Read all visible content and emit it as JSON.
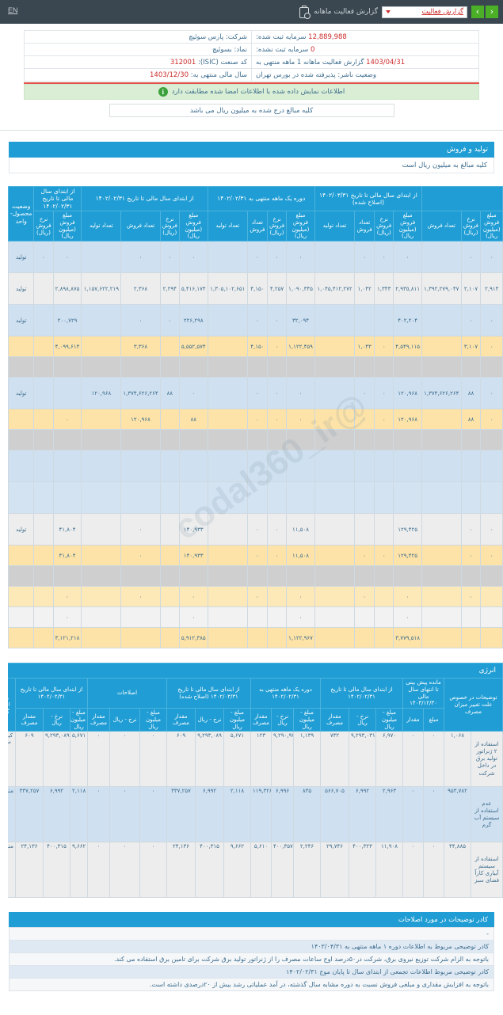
{
  "topbar": {
    "icon": "clipboard-check-icon",
    "title": "گزارش فعالیت ماهانه",
    "selected_report": "گزارش فعالیت",
    "prev_label": "‹",
    "next_label": "›",
    "en_label": "EN",
    "accent_green": "#4caf28",
    "bar_color": "#3a4750"
  },
  "info": {
    "company_label": "شرکت:",
    "company_value": "پارس سوئیچ",
    "symbol_label": "نماد:",
    "symbol_value": "بسوئیچ",
    "isic_label": "کد صنعت (ISIC):",
    "isic_value": "312001",
    "fiscal_label": "سال مالی منتهی به:",
    "fiscal_value": "1403/12/30",
    "registered_capital_label": "سرمایه ثبت شده:",
    "registered_capital_value": "12,889,988",
    "unregistered_capital_label": "سرمایه ثبت نشده:",
    "unregistered_capital_value": "0",
    "period_label": "گزارش فعالیت ماهانه  1  ماهه منتهی به",
    "period_value": "1403/04/31",
    "issuer_status_label": "وضعیت ناشر:",
    "issuer_status_value": "پذیرفته شده در بورس تهران",
    "green_note": "اطلاعات نمایش داده شده با اطلاعات امضا شده مطابقت دارد",
    "million_note": "کلیه مبالغ درج شده به میلیون ریال می باشد"
  },
  "production_section": {
    "title": "تولید و فروش",
    "subtitle": "کلیه مبالغ به میلیون ریال است",
    "watermark": "@codal360_ir",
    "group_headers": [
      "از ابتدای سال مالی تا تاریخ ۱۴۰۲/۰۳/۳۱ (اصلاح شده)",
      "دوره یک ماهه منتهی به ۱۴۰۲/۰۲/۳۱",
      "از ابتدای سال مالی تا تاریخ ۱۴۰۲/۰۲/۳۱",
      "از ابتدای سال مالی تا تاریخ ۱۴۰۲/۰۲/۳۱",
      "وضعیت محصول-واحد"
    ],
    "sub_headers": [
      "تعداد تولید",
      "تعداد فروش",
      "نرخ فروش (ریال)",
      "مبلغ فروش (میلیون ریال)"
    ],
    "status_col": "وضعیت محصول-واحد",
    "rows": [
      {
        "style": "blue",
        "status": "تولید",
        "cells": [
          "٠",
          "٠",
          "",
          "٠",
          "٠",
          "٠",
          "",
          "٠",
          "٠",
          "٠",
          "",
          "٠",
          "٠",
          "٠",
          "",
          "٠",
          "٠"
        ]
      },
      {
        "style": "grey",
        "status": "تولید",
        "cells": [
          "٢,٩١۴",
          "٢,١٠٧",
          "١,٣٩٢,٢٧٩,٠۴٧",
          "٢,٩٣٥,٨١١",
          "١,٣۴٣",
          "١,٠۴٢",
          "١,٠۴۵,۴١٢,٢٧٢",
          "١,٠٩٠,٣۴۵",
          "۴,٢۵٧",
          "۴,١۵٠",
          "١,٣٠۵,١٠٢,۶۵١",
          "۵,۴١۶,١٧۴",
          "٢,٢٩۴",
          "٢,٣۶٨",
          "١,١۵٧,۶٢٢,٢١٩",
          "٢,٨٩٨,٨٧۵"
        ]
      },
      {
        "style": "blue",
        "status": "تولید",
        "cells": [
          "٠",
          "٠",
          "",
          "۴٠٢,٢٠۴",
          "",
          "",
          "",
          "٣٢,٠٩۴",
          "٠",
          "٠",
          "",
          "٢٢۶,٢٩٨",
          "٠",
          "٠",
          "",
          "٢٠٠,٧٢٩"
        ]
      },
      {
        "style": "yellow",
        "status": "",
        "cells": [
          "٠",
          "٣,١٠٧",
          "",
          "۴,۵۴٩,١١۵",
          "٠",
          "١,٠۴٣",
          "",
          "١,١٢٢,۴۵٩",
          "٠",
          "۴,١۵٠",
          "",
          "۵,۵۵٢,۵٧۴",
          "",
          "٣,٣۶٨",
          "",
          "۴,٠٩٩,۶١۴"
        ]
      },
      {
        "style": "dgrey",
        "status": "",
        "cells": [
          "",
          "",
          "",
          "",
          "",
          "",
          "",
          "",
          "",
          "",
          "",
          "",
          "",
          "",
          "",
          ""
        ]
      },
      {
        "style": "blue",
        "status": "تولید",
        "cells": [
          "٠",
          "٨٨",
          "١,٣٧۴,۶٢۶,٢۶۴",
          "١٢٠,٩۶٨",
          "٠",
          "٠",
          "",
          "٠",
          "٠",
          "٠",
          "",
          "٠",
          "٨٨",
          "١,٣٧۴,۶٢۶,٢۶۴",
          "١٢٠,٩۶٨",
          ""
        ]
      },
      {
        "style": "yellow",
        "status": "",
        "cells": [
          "٠",
          "٨٨",
          "",
          "١٢٠,٩۶٨",
          "٠",
          "٠",
          "",
          "٠",
          "٠",
          "٠",
          "",
          "٨٨",
          "",
          "١٢٠,٩۶٨",
          "",
          "٠"
        ]
      },
      {
        "style": "dgrey",
        "status": "",
        "cells": [
          "",
          "",
          "",
          "",
          "",
          "",
          "",
          "",
          "",
          "",
          "",
          "",
          "",
          "",
          "",
          ""
        ]
      },
      {
        "style": "blue",
        "status": "",
        "cells": [
          "",
          "",
          "",
          "",
          "",
          "",
          "",
          "",
          "",
          "",
          "",
          "",
          "",
          "",
          "",
          ""
        ]
      },
      {
        "style": "blue2",
        "status": "",
        "cells": [
          "",
          "",
          "",
          "",
          "",
          "",
          "",
          "",
          "",
          "",
          "",
          "",
          "",
          "",
          "",
          ""
        ]
      },
      {
        "style": "grey",
        "status": "تولید",
        "cells": [
          "٠",
          "٠",
          "",
          "١٢٩,۴٢۵",
          "",
          "",
          "",
          "١١,۵٠٨",
          "٠",
          "٠",
          "",
          "١۴٠,٩٣٣",
          "",
          "٠",
          "",
          "۴١,٨٠۴"
        ]
      },
      {
        "style": "yellow",
        "status": "",
        "cells": [
          "٠",
          "٠",
          "",
          "١٢٩,۴٢۵",
          "٠",
          "٠",
          "",
          "١١,۵٠٨",
          "٠",
          "٠",
          "",
          "١۴٠,٩٣٣",
          "",
          "٠",
          "",
          "۴١,٨٠۴"
        ]
      },
      {
        "style": "dgrey",
        "status": "",
        "cells": [
          "",
          "",
          "",
          "",
          "",
          "",
          "",
          "",
          "",
          "",
          "",
          "",
          "",
          "",
          "",
          ""
        ]
      },
      {
        "style": "yellow2",
        "status": "",
        "cells": [
          "",
          "٠",
          "",
          "٠",
          "",
          "٠",
          "",
          "٠",
          "",
          "٠",
          "",
          "٠",
          "",
          "٠",
          "",
          "٠"
        ]
      },
      {
        "style": "lgrey",
        "status": "",
        "cells": [
          "",
          "",
          "",
          "٠",
          "",
          "",
          "",
          "٠",
          "",
          "",
          "",
          "٠",
          "",
          "",
          "",
          "٠"
        ]
      },
      {
        "style": "yellow",
        "status": "",
        "cells": [
          "",
          "",
          "",
          "٣,٧٧٩,۵١٨",
          "",
          "",
          "",
          "١,١٢٢,٩۶٧",
          "",
          "",
          "",
          "۵,٩١٢,٣٨۵",
          "",
          "",
          "",
          "٣,١٢١,٢١٨"
        ]
      }
    ]
  },
  "energy_section": {
    "title": "انرژی",
    "unit_col_header": "واحد اندازه گیری",
    "group_headers": [
      "از ابتدای سال مالی تا تاریخ ۱۴۰۲/۰۲/۳۱",
      "اصلاحات",
      "از ابتدای سال مالی تا تاریخ ۱۴۰۲/۰۳/۳۱ (اصلاح شده)",
      "دوره یک ماهه منتهی به ۱۴۰۲/۰۲/۳۱",
      "از ابتدای سال مالی تا تاریخ ۱۴۰۲/۰۲/۳۱",
      "مانده پیش بینی تا انتهای سال مالی ۱۴۰۳/۱۲/۳۰",
      "توضیحات در خصوص علت تغییر میزان مصرف"
    ],
    "sub_headers": [
      "مقدار مصرف",
      "نرخ - ریال",
      "مبلغ - میلیون ریال"
    ],
    "extra_sub": [
      "مقدار",
      "مبلغ"
    ],
    "rows": [
      {
        "unit": "کیلووات ساعت",
        "desc": "استفاده از ۲ ژنراتور تولید برق در داخل شرکت",
        "cells": [
          "۶٠٩",
          "٩,٢٩٣,٠٨٩",
          "۵,۶٧١",
          "٠",
          "٠",
          "٠",
          "۶٠٩",
          "٩,٢٩٣,٠٨٩",
          "۵,۶٧١",
          "١٢٣",
          "٩,٢٩٠,٩٧٧",
          "١,١٣٩",
          "٧٣٢",
          "٩,٢٩٣,٠٣١",
          "۶,٩٧٠",
          "٠",
          "٠",
          "١,٠۶٨"
        ]
      },
      {
        "unit": "مترمکعب",
        "desc": "عدم استفاده از سیستم آب گرم",
        "cells": [
          "٣٣٧,٢۵٧",
          "۶,٩٩٢",
          "٢,١١٨",
          "٠",
          "٠",
          "٠",
          "٣٣٧,٢۵٧",
          "۶,٩٩٢",
          "٢,١١٨",
          "١١٩,٣٢٨",
          "۶,٩٩۶",
          "٨٣۵",
          "۵۶۶,٧٠۵",
          "۶,٩٩٢",
          "٢,٩۶٣",
          "٠",
          "٠",
          "٩۵٣,٧٨٢"
        ]
      },
      {
        "unit": "مترمکعب",
        "desc": "استفاده از سیستم آبیاری کاراً فضای سبز",
        "cells": [
          "٢۴,١٣۶",
          "۴٠٠,٣١۵",
          "٩,۶۶٢",
          "٠",
          "٠",
          "٠",
          "٢۴,١٣۶",
          "۴٠٠,٣١۵",
          "٩,۶۶٢",
          "۵,۶١٠",
          "۴٠٠,٣۵٧",
          "٢,٢۴۶",
          "٢٩,٧۴۶",
          "۴٠٠,٣٢٣",
          "١١,٩٠٨",
          "٠",
          "٠",
          "۴۴,٨٨۵"
        ]
      }
    ]
  },
  "notes_section": {
    "title": "کادر توضیحات در مورد اصلاحات",
    "rows": [
      "-",
      "کادر توضیحی مربوط به اطلاعات دوره ۱ ماهه منتهی به ۱۴۰۳/۰۴/۳۱",
      "باتوجه به الزام شرکت توزیع نیروی برق، شرکت در۵۰درصد اوج ساعات مصرف را از ژنراتور تولید برق شرکت برای تامین برق استفاده می کند.",
      "کادر توضیحی مربوط اطلاعات تجمعی از ابتدای سال تا پایان موج ۱۴۰۲/۰۲/۳۱",
      "باتوجه به افزایش مقداری و مبلغی فروش نسبت به دوره مشابه سال گذشته، در آمد عملیاتی رشد بیش از ۲۰درصدی داشته است."
    ]
  }
}
